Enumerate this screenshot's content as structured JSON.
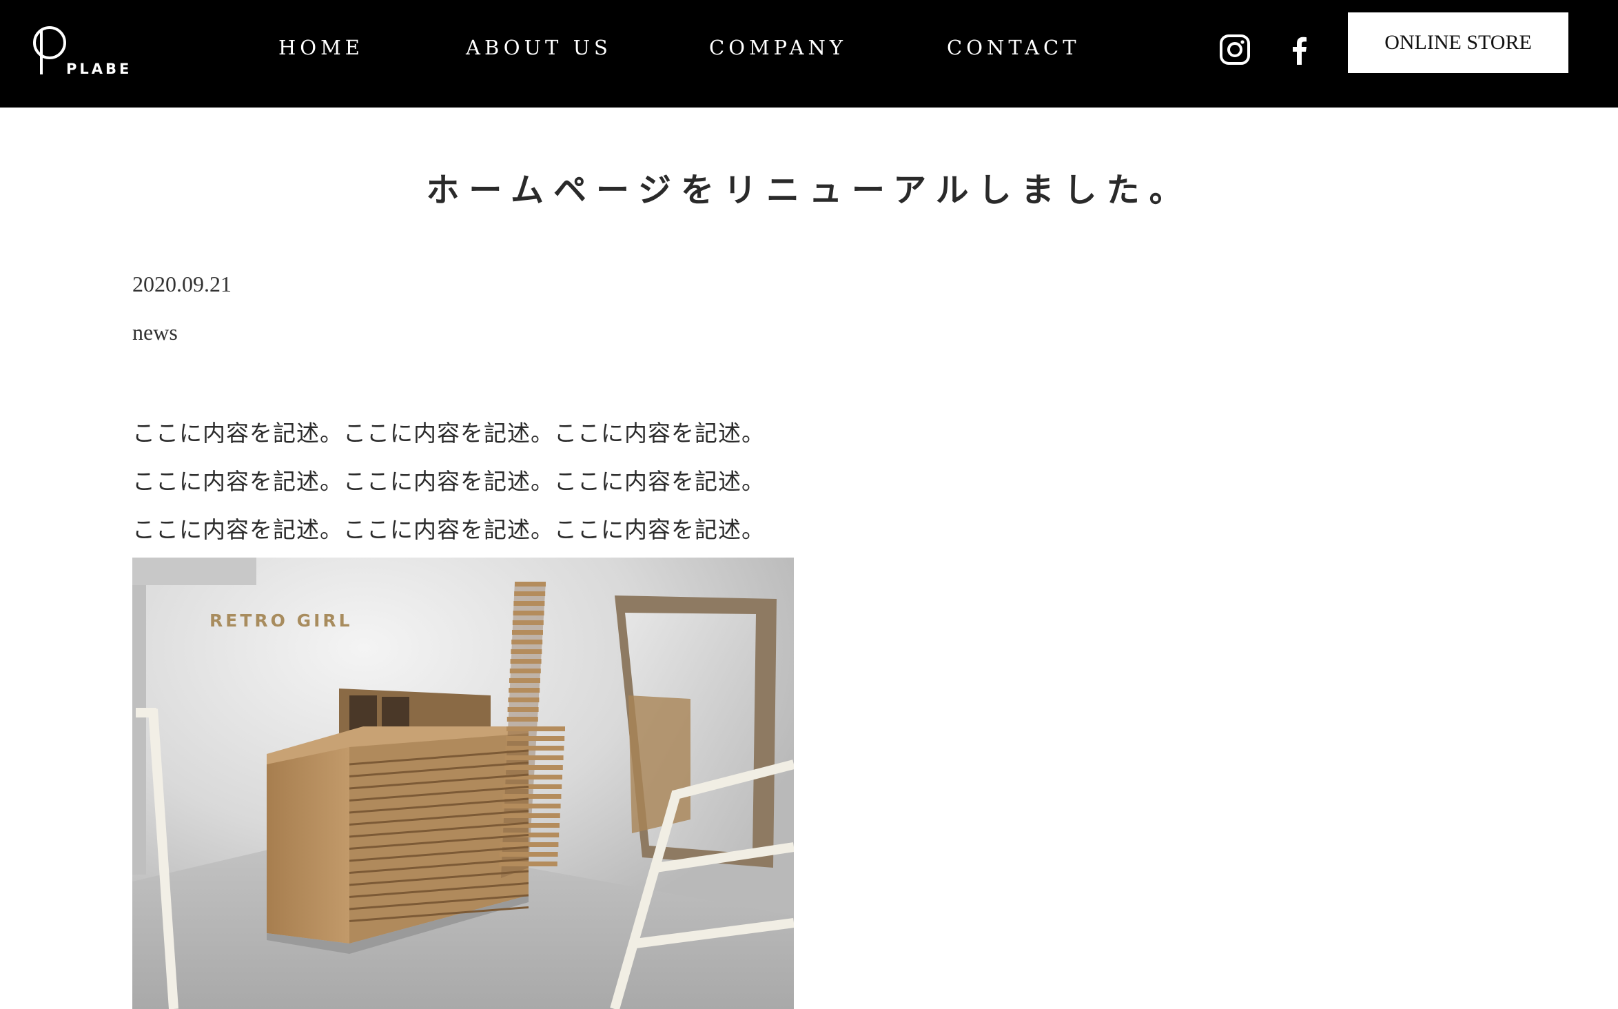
{
  "header": {
    "logo_text": "PLABE",
    "nav": [
      {
        "label": "HOME"
      },
      {
        "label": "ABOUT US"
      },
      {
        "label": "COMPANY"
      },
      {
        "label": "CONTACT"
      }
    ],
    "social": [
      {
        "icon": "instagram-icon"
      },
      {
        "icon": "facebook-icon"
      }
    ],
    "store_button_label": "ONLINE STORE"
  },
  "article": {
    "title": "ホームページをリニューアルしました。",
    "date": "2020.09.21",
    "category": "news",
    "body_lines": [
      "ここに内容を記述。ここに内容を記述。ここに内容を記述。",
      "ここに内容を記述。ここに内容を記述。ここに内容を記述。",
      "ここに内容を記述。ここに内容を記述。ここに内容を記述。"
    ],
    "photo": {
      "sign_text": "RETRO GIRL"
    }
  },
  "colors": {
    "header_bg": "#000000",
    "header_text": "#ffffff",
    "page_bg": "#ffffff",
    "wood": "#b08a5c"
  }
}
